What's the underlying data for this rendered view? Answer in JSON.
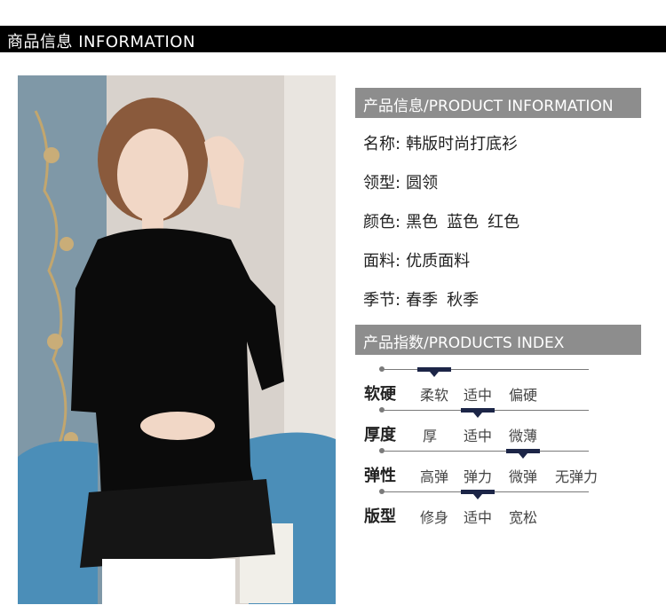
{
  "banner": {
    "title": "商品信息  INFORMATION"
  },
  "info_header": "产品信息/PRODUCT INFORMATION",
  "info": [
    {
      "label": "名称:",
      "values": [
        "韩版时尚打底衫"
      ]
    },
    {
      "label": "领型:",
      "values": [
        "圆领"
      ]
    },
    {
      "label": "颜色:",
      "values": [
        "黑色",
        "蓝色",
        "红色"
      ]
    },
    {
      "label": "面料:",
      "values": [
        "优质面料"
      ]
    },
    {
      "label": "季节:",
      "values": [
        "春季",
        "秋季"
      ]
    }
  ],
  "index_header": "产品指数/PRODUCTS INDEX",
  "index": [
    {
      "label": "软硬",
      "options": [
        "柔软",
        "适中",
        "偏硬"
      ],
      "selected": 0
    },
    {
      "label": "厚度",
      "options": [
        "厚",
        "适中",
        "微薄"
      ],
      "selected": 1
    },
    {
      "label": "弹性",
      "options": [
        "高弹",
        "弹力",
        "微弹",
        "无弹力"
      ],
      "selected": 2
    },
    {
      "label": "版型",
      "options": [
        "修身",
        "适中",
        "宽松"
      ],
      "selected": 1
    }
  ],
  "colors": {
    "banner_bg": "#000000",
    "header_bg": "#8d8d8d",
    "marker": "#1c2547"
  }
}
